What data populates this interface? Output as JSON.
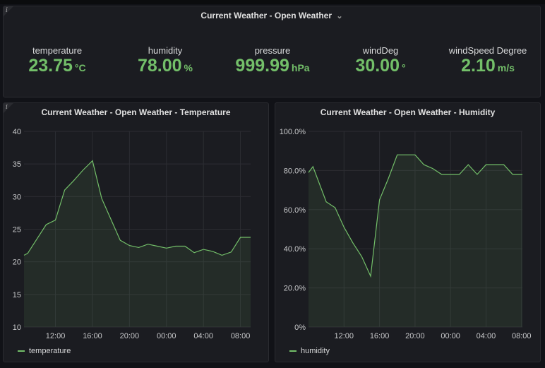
{
  "stat_panel": {
    "title": "Current Weather - Open Weather",
    "title_chevron": "⌄",
    "info": "i",
    "stats": [
      {
        "label": "temperature",
        "value": "23.75",
        "unit": "°C"
      },
      {
        "label": "humidity",
        "value": "78.00",
        "unit": "%"
      },
      {
        "label": "pressure",
        "value": "999.99",
        "unit": "hPa"
      },
      {
        "label": "windDeg",
        "value": "30.00",
        "unit": "°"
      },
      {
        "label": "windSpeed Degree",
        "value": "2.10",
        "unit": "m/s"
      }
    ]
  },
  "temp_panel": {
    "title": "Current Weather - Open Weather - Temperature",
    "info": "i",
    "legend": "temperature"
  },
  "humid_panel": {
    "title": "Current Weather - Open Weather - Humidity",
    "legend": "humidity"
  },
  "colors": {
    "series": "#73bf69",
    "background": "#111217",
    "panel": "#1b1c21"
  },
  "chart_data": [
    {
      "type": "area",
      "title": "Current Weather - Open Weather - Temperature",
      "xlabel": "",
      "ylabel": "",
      "ylim": [
        10,
        40
      ],
      "yticks": [
        "10",
        "15",
        "20",
        "25",
        "30",
        "35",
        "40"
      ],
      "xticks": [
        "12:00",
        "16:00",
        "20:00",
        "00:00",
        "04:00",
        "08:00"
      ],
      "xtick_hours": [
        12,
        16,
        20,
        24,
        28,
        32
      ],
      "xlim_hours": [
        8.6,
        33.1
      ],
      "grid": true,
      "legend": "bottom-left",
      "series": [
        {
          "name": "temperature",
          "x": [
            8.6,
            9.0,
            10.0,
            11.0,
            12.0,
            13.0,
            14.0,
            15.0,
            16.0,
            17.0,
            18.0,
            19.0,
            20.0,
            21.0,
            22.0,
            23.0,
            24.0,
            25.0,
            26.0,
            27.0,
            28.0,
            29.0,
            30.0,
            31.0,
            32.0,
            33.1
          ],
          "values": [
            21.0,
            21.3,
            23.5,
            25.7,
            26.4,
            31.0,
            32.5,
            34.1,
            35.5,
            29.7,
            26.5,
            23.3,
            22.5,
            22.2,
            22.7,
            22.4,
            22.1,
            22.4,
            22.4,
            21.4,
            21.9,
            21.6,
            21.0,
            21.5,
            23.75,
            23.75
          ]
        }
      ]
    },
    {
      "type": "area",
      "title": "Current Weather - Open Weather - Humidity",
      "xlabel": "",
      "ylabel": "",
      "ylim": [
        0,
        100
      ],
      "yticks": [
        "0%",
        "20.0%",
        "40.0%",
        "60.0%",
        "80.0%",
        "100.0%"
      ],
      "xticks": [
        "12:00",
        "16:00",
        "20:00",
        "00:00",
        "04:00",
        "08:00"
      ],
      "xtick_hours": [
        12,
        16,
        20,
        24,
        28,
        32
      ],
      "xlim_hours": [
        8.0,
        32.1
      ],
      "grid": true,
      "legend": "bottom-left",
      "series": [
        {
          "name": "humidity",
          "x": [
            8.0,
            8.5,
            10.0,
            11.0,
            12.0,
            13.0,
            14.0,
            15.0,
            16.0,
            17.0,
            18.0,
            19.0,
            20.0,
            21.0,
            22.0,
            23.0,
            24.0,
            25.0,
            26.0,
            27.0,
            28.0,
            29.0,
            30.0,
            31.0,
            32.0,
            32.1
          ],
          "values": [
            79,
            82,
            64,
            61,
            51,
            43,
            36,
            26,
            65,
            76,
            88,
            88,
            88,
            83,
            81,
            78,
            78,
            78,
            83,
            78,
            83,
            83,
            83,
            78,
            78,
            78
          ]
        }
      ]
    }
  ]
}
